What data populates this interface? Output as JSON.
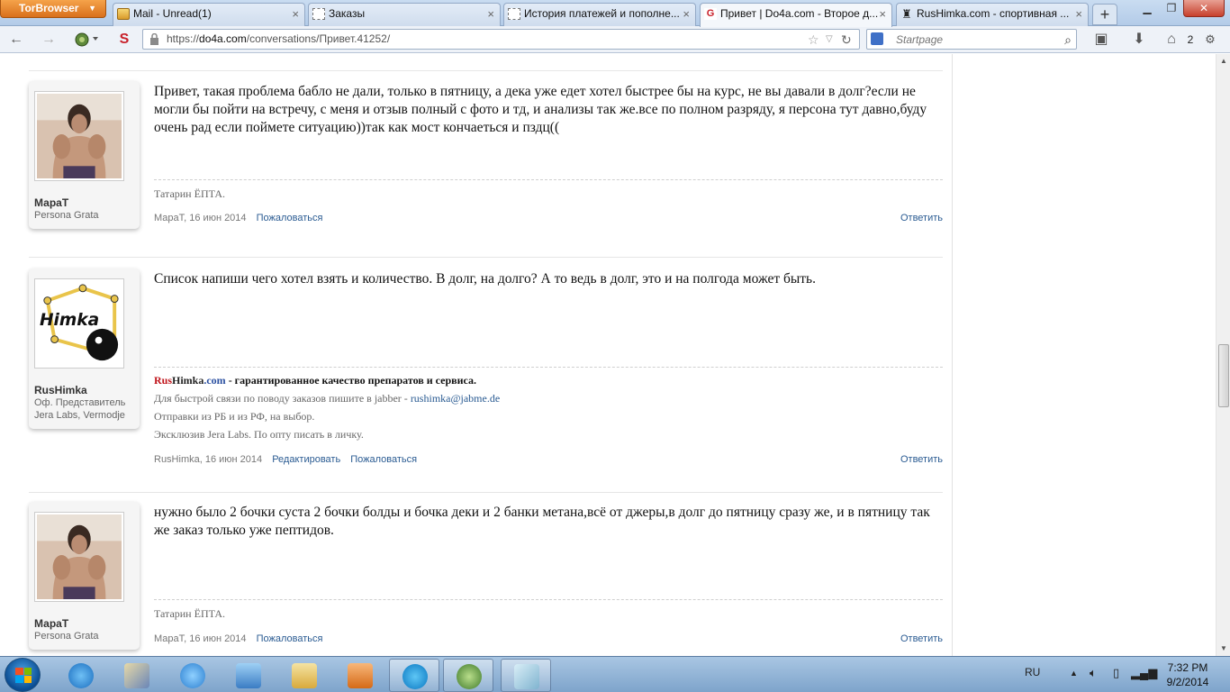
{
  "browser": {
    "app_button": "TorBrowser",
    "tabs": [
      {
        "title": "Mail - Unread(1)",
        "icon": "mail-icon",
        "active": false
      },
      {
        "title": "Заказы",
        "icon": "blank-page-icon",
        "active": false
      },
      {
        "title": "История платежей и пополне...",
        "icon": "blank-page-icon",
        "active": false
      },
      {
        "title": "Привет | Do4a.com - Второе д...",
        "icon": "do4a-icon",
        "active": true
      },
      {
        "title": "RusHimka.com - спортивная ...",
        "icon": "dumbbell-icon",
        "active": false
      }
    ],
    "new_tab": "+",
    "url_prefix": "https://",
    "url_host": "do4a.com",
    "url_path": "/conversations/Привет.41252/",
    "search_placeholder": "Startpage",
    "badge_count": "2"
  },
  "posts": [
    {
      "author": "МараТ",
      "user_title": "Persona Grata",
      "avatar": "user-photo",
      "message": "Привет, такая проблема бабло не дали, только в пятницу, а дека уже едет хотел быстрее бы на курс, не вы давали в долг?если не могли бы пойти на встречу, с меня и отзыв полный с фото и тд, и анализы так же.все по полном разряду, я персона тут давно,буду очень рад если поймете ситуацию))так как мост кончаеться и пздц((",
      "signature": "Татарин ЁПТА.",
      "date": "МараТ, 16 июн 2014",
      "actions": [
        "Пожаловаться"
      ],
      "reply": "Ответить"
    },
    {
      "author": "RusHimka",
      "user_title": "Оф. Представитель",
      "user_title2": "Jera Labs, Vermodje",
      "avatar": "himka-logo",
      "logo_text": "Himka",
      "message": "Список напиши чего хотел взять и количество. В долг, на долго? А то ведь в долг, это и на полгода может быть.",
      "sig_brand_rus": "Rus",
      "sig_brand_himka": "Himka",
      "sig_brand_com": ".com",
      "sig_line1": " - гарантированное качество препаратов и сервиса.",
      "sig_line2": "Для быстрой связи по поводу заказов пишите в jabber - ",
      "sig_email": "rushimka@jabme.de",
      "sig_line3": "Отправки из РБ и из РФ, на выбор.",
      "sig_line4": "Эксклюзив Jera Labs. По опту писать в личку.",
      "date": "RusHimka, 16 июн 2014",
      "actions": [
        "Редактировать",
        "Пожаловаться"
      ],
      "reply": "Ответить"
    },
    {
      "author": "МараТ",
      "user_title": "Persona Grata",
      "avatar": "user-photo",
      "message": "нужно было 2 бочки суста 2 бочки болды и бочка деки и 2 банки метана,всё от джеры,в долг до пятницу сразу же, и в пятницу так же заказ только уже пептидов.",
      "signature": "Татарин ЁПТА.",
      "date": "МараТ, 16 июн 2014",
      "actions": [
        "Пожаловаться"
      ],
      "reply": "Ответить"
    }
  ],
  "taskbar": {
    "language": "RU",
    "time": "7:32 PM",
    "date": "9/2/2014"
  }
}
